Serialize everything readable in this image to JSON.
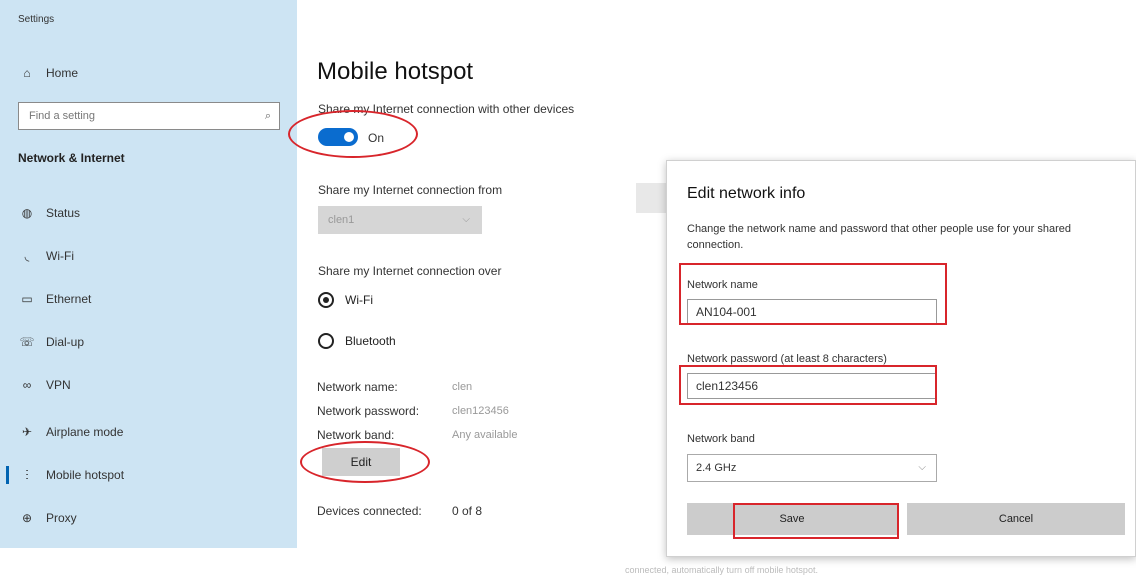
{
  "window": {
    "app_title": "Settings"
  },
  "sidebar": {
    "home": "Home",
    "search_placeholder": "Find a setting",
    "section": "Network & Internet",
    "items": [
      {
        "label": "Status",
        "icon": "globe-icon"
      },
      {
        "label": "Wi-Fi",
        "icon": "wifi-icon"
      },
      {
        "label": "Ethernet",
        "icon": "ethernet-icon"
      },
      {
        "label": "Dial-up",
        "icon": "dialup-icon"
      },
      {
        "label": "VPN",
        "icon": "vpn-icon"
      },
      {
        "label": "Airplane mode",
        "icon": "airplane-icon"
      },
      {
        "label": "Mobile hotspot",
        "icon": "hotspot-icon",
        "active": true
      },
      {
        "label": "Proxy",
        "icon": "globe-icon"
      }
    ]
  },
  "main": {
    "title": "Mobile hotspot",
    "share_label": "Share my Internet connection with other devices",
    "toggle_state": "On",
    "share_from_label": "Share my Internet connection from",
    "share_from_value": "clen1",
    "share_over_label": "Share my Internet connection over",
    "options": [
      "Wi-Fi",
      "Bluetooth"
    ],
    "selected_option": "Wi-Fi",
    "network_name_key": "Network name:",
    "network_name_val": "clen",
    "network_password_key": "Network password:",
    "network_password_val": "clen123456",
    "network_band_key": "Network band:",
    "network_band_val": "Any available",
    "edit_button": "Edit",
    "devices_key": "Devices connected:",
    "devices_val": "0 of 8"
  },
  "background_text": {
    "bottom": "connected, automatically turn off mobile hotspot."
  },
  "dialog": {
    "title": "Edit network info",
    "description": "Change the network name and password that other people use for your shared connection.",
    "name_label": "Network name",
    "name_value": "AN104-001",
    "password_label": "Network password (at least 8 characters)",
    "password_value": "clen123456",
    "band_label": "Network band",
    "band_value": "2.4 GHz",
    "save_button": "Save",
    "cancel_button": "Cancel"
  },
  "colors": {
    "sidebar_bg": "#cde4f3",
    "accent": "#0a6ccf",
    "highlight_red": "#d8252b"
  }
}
